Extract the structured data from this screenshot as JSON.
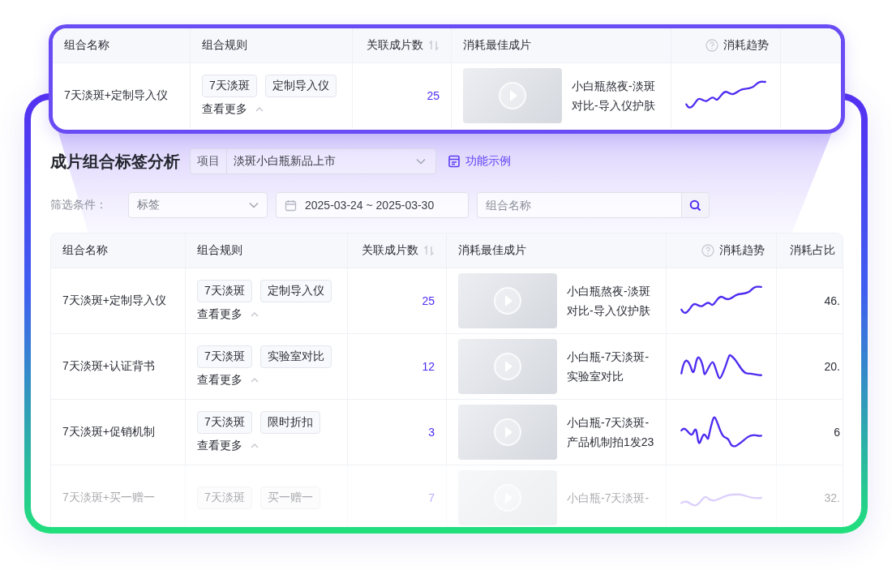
{
  "highlight_card": {
    "columns": [
      {
        "label": "组合名称",
        "sortable": false,
        "help": false
      },
      {
        "label": "组合规则",
        "sortable": false,
        "help": false
      },
      {
        "label": "关联成片数",
        "sortable": true,
        "help": false
      },
      {
        "label": "消耗最佳成片",
        "sortable": false,
        "help": false
      },
      {
        "label": "消耗趋势",
        "sortable": false,
        "help": true
      }
    ],
    "row": {
      "name": "7天淡斑+定制导入仪",
      "tags": [
        "7天淡斑",
        "定制导入仪"
      ],
      "more": "查看更多",
      "count": "25",
      "video_title": "小白瓶熬夜-淡斑对比-导入仪护肤",
      "faded": false
    }
  },
  "page": {
    "title": "成片组合标签分析",
    "project": {
      "label": "项目",
      "value": "淡斑小白瓶新品上市"
    },
    "example_link": "功能示例"
  },
  "filters": {
    "label": "筛选条件：",
    "tag_select": "标签",
    "date_range": "2025-03-24 ~ 2025-03-30",
    "search": {
      "placeholder": "组合名称"
    }
  },
  "table": {
    "columns": [
      {
        "label": "组合名称",
        "sortable": false,
        "help": false
      },
      {
        "label": "组合规则",
        "sortable": false,
        "help": false
      },
      {
        "label": "关联成片数",
        "sortable": true,
        "help": false
      },
      {
        "label": "消耗最佳成片",
        "sortable": false,
        "help": false
      },
      {
        "label": "消耗趋势",
        "sortable": false,
        "help": true
      },
      {
        "label": "消耗占比",
        "sortable": false,
        "help": false
      }
    ],
    "rows": [
      {
        "name": "7天淡斑+定制导入仪",
        "tags": [
          "7天淡斑",
          "定制导入仪"
        ],
        "more": "查看更多",
        "count": "25",
        "video_title": "小白瓶熬夜-淡斑对比-导入仪护肤",
        "share": "46.",
        "faded": false
      },
      {
        "name": "7天淡斑+认证背书",
        "tags": [
          "7天淡斑",
          "实验室对比"
        ],
        "more": "查看更多",
        "count": "12",
        "video_title": "小白瓶-7天淡斑-实验室对比",
        "share": "20.",
        "faded": false
      },
      {
        "name": "7天淡斑+促销机制",
        "tags": [
          "7天淡斑",
          "限时折扣"
        ],
        "more": "查看更多",
        "count": "3",
        "video_title": "小白瓶-7天淡斑-产品机制拍1发23",
        "share": "6",
        "faded": false
      },
      {
        "name": "7天淡斑+买一赠一",
        "tags": [
          "7天淡斑",
          "买一赠一"
        ],
        "count": "7",
        "video_title": "小白瓶-7天淡斑-",
        "share": "32.",
        "faded": true
      }
    ]
  }
}
